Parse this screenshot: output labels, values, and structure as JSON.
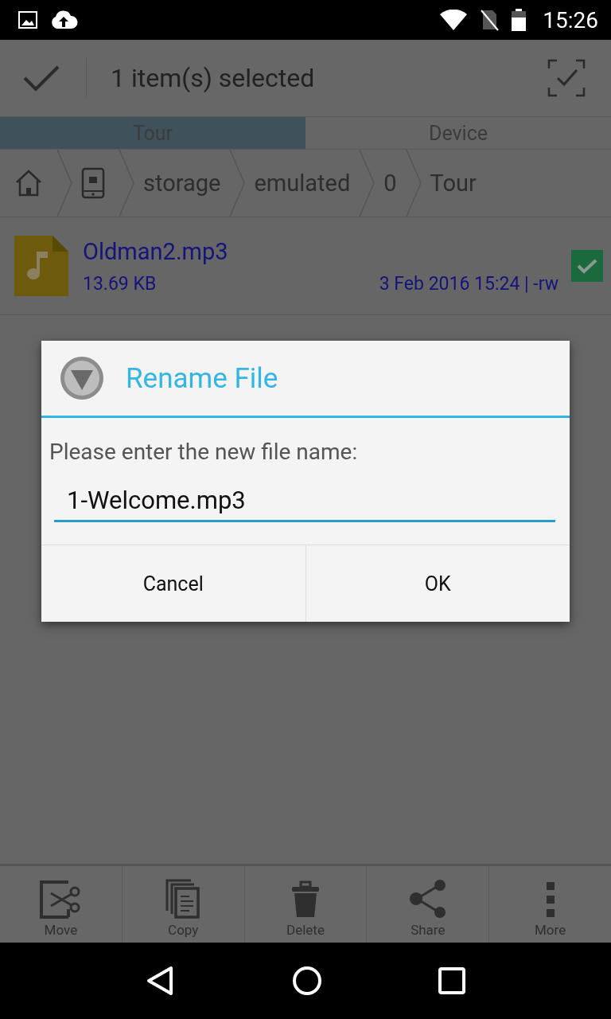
{
  "status_bar": {
    "time": "15:26"
  },
  "action_bar": {
    "title": "1 item(s) selected"
  },
  "tabs": [
    {
      "label": "Tour",
      "selected": true
    },
    {
      "label": "Device",
      "selected": false
    }
  ],
  "breadcrumb": [
    {
      "kind": "home"
    },
    {
      "kind": "device"
    },
    {
      "kind": "text",
      "label": "storage"
    },
    {
      "kind": "text",
      "label": "emulated"
    },
    {
      "kind": "text",
      "label": "0"
    },
    {
      "kind": "text",
      "label": "Tour"
    }
  ],
  "files": [
    {
      "name": "Oldman2.mp3",
      "size": "13.69 KB",
      "details": "3 Feb 2016 15:24 | -rw",
      "checked": true
    }
  ],
  "dialog": {
    "title": "Rename File",
    "prompt": "Please enter the new file name:",
    "value": "1-Welcome.mp3",
    "buttons": [
      "Cancel",
      "OK"
    ]
  },
  "bottom_actions": [
    {
      "kind": "move",
      "label": "Move"
    },
    {
      "kind": "copy",
      "label": "Copy"
    },
    {
      "kind": "delete",
      "label": "Delete"
    },
    {
      "kind": "share",
      "label": "Share"
    },
    {
      "kind": "more",
      "label": "More"
    }
  ]
}
